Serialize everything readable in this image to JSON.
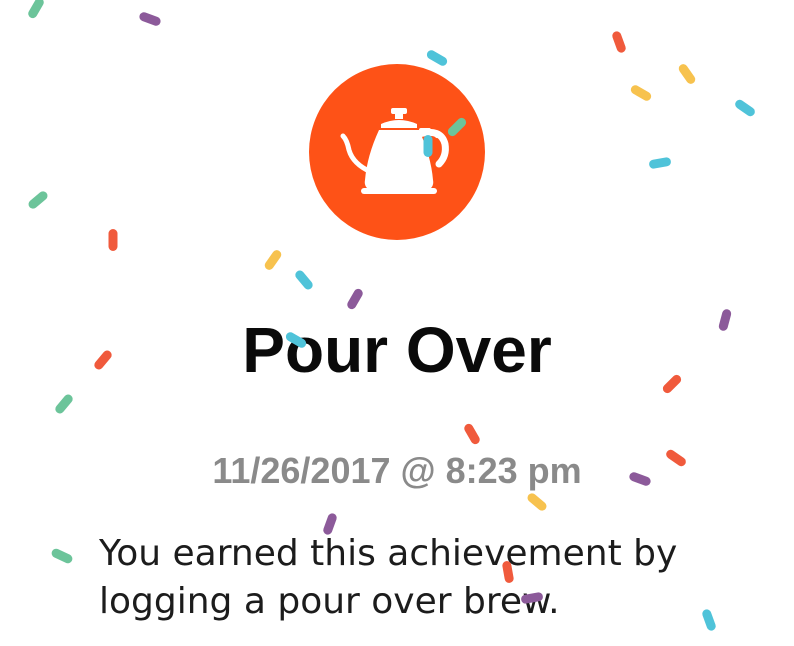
{
  "achievement": {
    "title": "Pour Over",
    "earned_at": "11/26/2017 @ 8:23 pm",
    "description": "You earned this achievement by logging a pour over brew.",
    "icon": "pour-over-kettle-icon",
    "badge_color": "#FE5217"
  },
  "confetti": {
    "colors": [
      "#F05A3C",
      "#4FC3D9",
      "#F7C24E",
      "#8C5A9A",
      "#6CC49A"
    ]
  }
}
